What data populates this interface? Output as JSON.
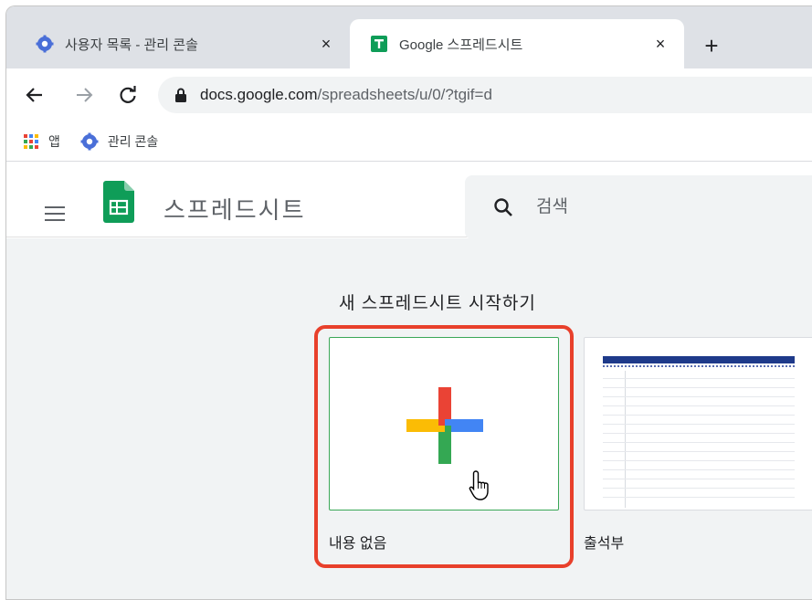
{
  "browser": {
    "tabs": [
      {
        "title": "사용자 목록 - 관리 콘솔",
        "favicon": "admin-console-icon",
        "active": false
      },
      {
        "title": "Google 스프레드시트",
        "favicon": "sheets-icon",
        "active": true
      }
    ],
    "close_glyph": "×",
    "new_tab_glyph": "+",
    "url_host": "docs.google.com",
    "url_path": "/spreadsheets/u/0/?tgif=d"
  },
  "bookmarks": [
    {
      "label": "앱",
      "icon": "apps-grid-icon"
    },
    {
      "label": "관리 콘솔",
      "icon": "admin-console-icon"
    }
  ],
  "app": {
    "title": "스프레드시트",
    "search_placeholder": "검색"
  },
  "gallery": {
    "heading": "새 스프레드시트 시작하기",
    "templates": [
      {
        "label": "내용 없음",
        "icon": "plus-icon",
        "highlighted": true
      },
      {
        "label": "출석부",
        "icon": "attendance-thumbnail",
        "highlighted": false
      }
    ]
  },
  "colors": {
    "highlight": "#e8402b",
    "sheets_green": "#0f9d58",
    "google_blue": "#4285f4",
    "google_red": "#ea4335",
    "google_yellow": "#fbbc05",
    "google_green": "#34a853"
  }
}
